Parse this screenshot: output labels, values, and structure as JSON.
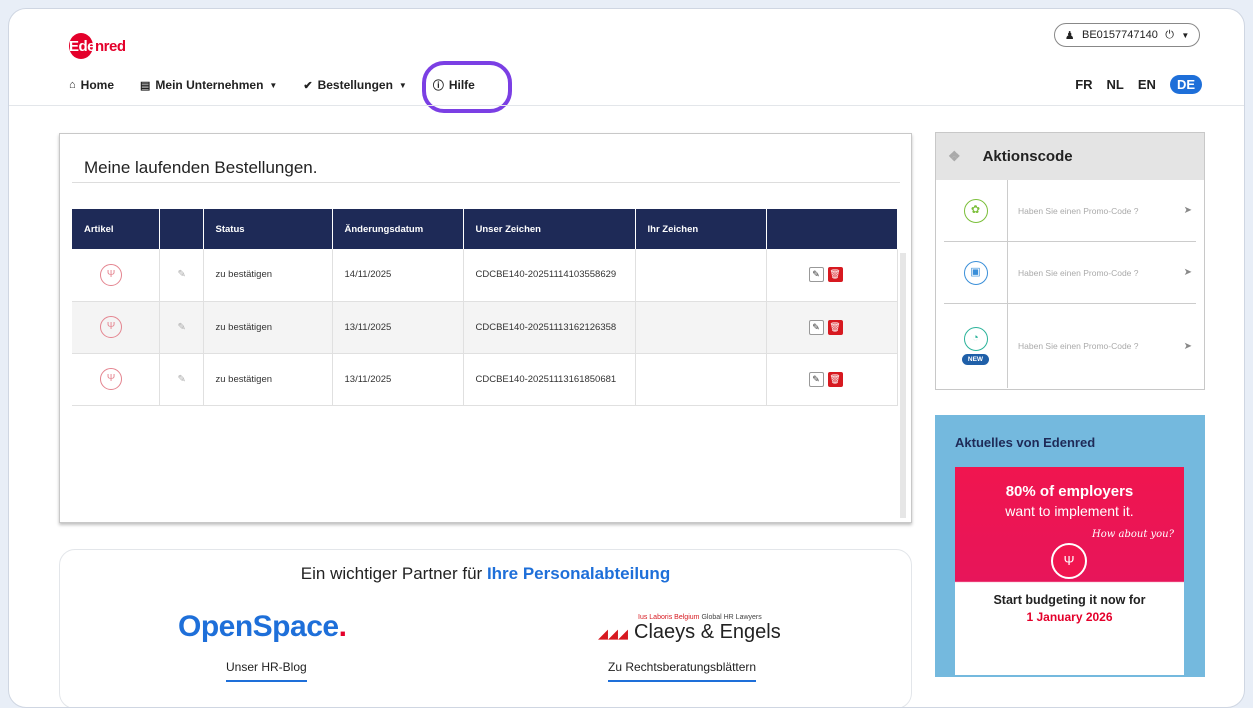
{
  "header": {
    "logo_text_a": "Ede",
    "logo_text_b": "nred",
    "user_id": "BE0157747140",
    "nav": [
      {
        "label": "Home",
        "icon": "home-icon"
      },
      {
        "label": "Mein Unternehmen",
        "icon": "building-icon"
      },
      {
        "label": "Bestellungen",
        "icon": "check-circle-icon"
      },
      {
        "label": "Hilfe",
        "icon": "info-icon"
      }
    ],
    "languages": [
      "FR",
      "NL",
      "EN",
      "DE"
    ],
    "active_language": "DE"
  },
  "orders": {
    "title": "Meine laufenden Bestellungen.",
    "columns": [
      "Artikel",
      "",
      "Status",
      "Änderungsdatum",
      "Unser Zeichen",
      "Ihr Zeichen",
      ""
    ],
    "rows": [
      {
        "status": "zu bestätigen",
        "date": "14/11/2025",
        "ref": "CDCBE140-20251114103558629",
        "your_ref": ""
      },
      {
        "status": "zu bestätigen",
        "date": "13/11/2025",
        "ref": "CDCBE140-20251113162126358",
        "your_ref": ""
      },
      {
        "status": "zu bestätigen",
        "date": "13/11/2025",
        "ref": "CDCBE140-20251113161850681",
        "your_ref": ""
      }
    ]
  },
  "partners": {
    "title_plain": "Ein wichtiger Partner für",
    "title_bold": "Ihre Personalabteilung",
    "openspace": "OpenSpace",
    "openspace_dot": ".",
    "claeys_small_red": "Ius Laboris Belgium",
    "claeys_small": "Global HR Lawyers",
    "claeys_big": "Claeys & Engels",
    "link_left": "Unser HR-Blog",
    "link_right": "Zu Rechtsberatungsblättern"
  },
  "aktion": {
    "title": "Aktionscode",
    "items": [
      {
        "label": "Haben Sie einen Promo-Code ?",
        "icon": "leaf-icon",
        "color": "#7bbf3a"
      },
      {
        "label": "Haben Sie einen Promo-Code ?",
        "icon": "gift-icon",
        "color": "#3a8fd9"
      },
      {
        "label": "Haben Sie einen Promo-Code ?",
        "icon": "bag-icon",
        "color": "#2bb39a",
        "badge": "NEW"
      }
    ]
  },
  "news": {
    "title": "Aktuelles von Edenred",
    "ad_line1": "80% of employers",
    "ad_line2": "want to implement it.",
    "ad_line3": "How about you?",
    "ad_line4": "Start budgeting it now for",
    "ad_line5": "1 January 2026"
  },
  "colors": {
    "brand_red": "#e4002b",
    "brand_blue": "#1e6fd9",
    "table_header": "#1e2a57",
    "highlight_purple": "#7b3fe4",
    "news_bg": "#74b9de"
  }
}
